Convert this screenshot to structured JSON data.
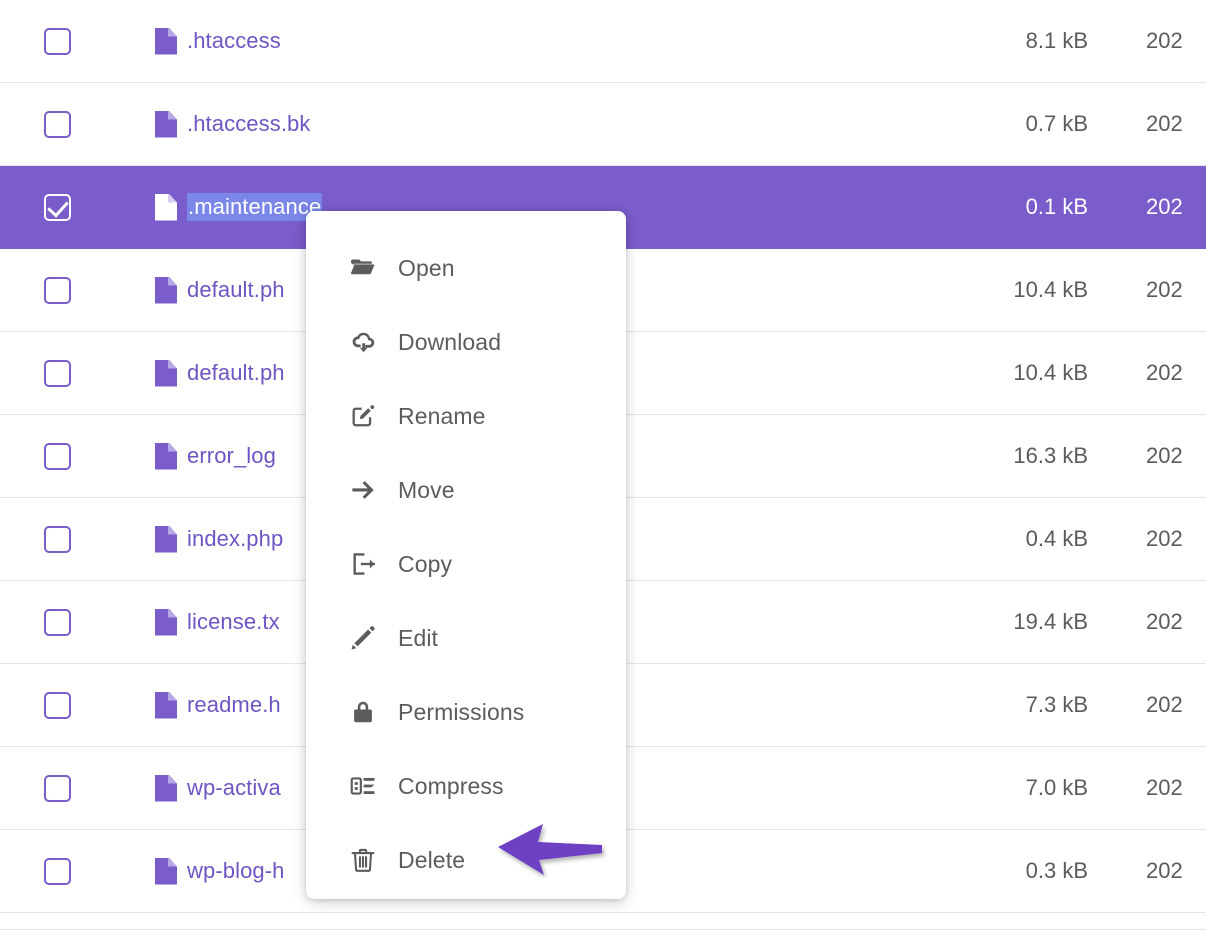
{
  "accent_color": "#7a5ccb",
  "file_name_color": "#6f55c4",
  "selection_highlight_color": "#7b87e8",
  "menu_text_color": "#5c5c5c",
  "arrow_color": "#6d3fc4",
  "file_list": {
    "rows": [
      {
        "name": ".htaccess",
        "name_prefix": "",
        "name_selected": "",
        "size": "8.1 kB",
        "date": "202",
        "checked": false,
        "selected": false
      },
      {
        "name": ".htaccess.bk",
        "name_prefix": "",
        "name_selected": "",
        "size": "0.7 kB",
        "date": "202",
        "checked": false,
        "selected": false
      },
      {
        "name": ".maintenance",
        "name_prefix": "",
        "name_selected": ".maintenance",
        "size": "0.1 kB",
        "date": "202",
        "checked": true,
        "selected": true
      },
      {
        "name": "default.ph",
        "name_prefix": "default.ph",
        "name_selected": "",
        "size": "10.4 kB",
        "date": "202",
        "checked": false,
        "selected": false
      },
      {
        "name": "default.ph",
        "name_prefix": "default.ph",
        "name_selected": "",
        "size": "10.4 kB",
        "date": "202",
        "checked": false,
        "selected": false
      },
      {
        "name": "error_log",
        "name_prefix": "error_log",
        "name_selected": "",
        "size": "16.3 kB",
        "date": "202",
        "checked": false,
        "selected": false
      },
      {
        "name": "index.php",
        "name_prefix": "index.php",
        "name_selected": "",
        "size": "0.4 kB",
        "date": "202",
        "checked": false,
        "selected": false
      },
      {
        "name": "license.tx",
        "name_prefix": "license.tx",
        "name_selected": "",
        "size": "19.4 kB",
        "date": "202",
        "checked": false,
        "selected": false
      },
      {
        "name": "readme.h",
        "name_prefix": "readme.h",
        "name_selected": "",
        "size": "7.3 kB",
        "date": "202",
        "checked": false,
        "selected": false
      },
      {
        "name": "wp-activa",
        "name_prefix": "wp-activa",
        "name_selected": "",
        "size": "7.0 kB",
        "date": "202",
        "checked": false,
        "selected": false
      },
      {
        "name": "wp-blog-h",
        "name_prefix": "wp-blog-h",
        "name_selected": "",
        "size": "0.3 kB",
        "date": "202",
        "checked": false,
        "selected": false
      }
    ]
  },
  "context_menu": {
    "items": [
      {
        "label": "Open",
        "icon": "folder-icon"
      },
      {
        "label": "Download",
        "icon": "cloud-download-icon"
      },
      {
        "label": "Rename",
        "icon": "rename-pencil-square-icon"
      },
      {
        "label": "Move",
        "icon": "arrow-right-icon"
      },
      {
        "label": "Copy",
        "icon": "copy-export-icon"
      },
      {
        "label": "Edit",
        "icon": "pencil-icon"
      },
      {
        "label": "Permissions",
        "icon": "lock-icon"
      },
      {
        "label": "Compress",
        "icon": "compress-archive-icon"
      },
      {
        "label": "Delete",
        "icon": "trash-icon"
      }
    ]
  },
  "annotation": {
    "arrow": "left-pointing-arrow",
    "points_at": "Delete"
  }
}
